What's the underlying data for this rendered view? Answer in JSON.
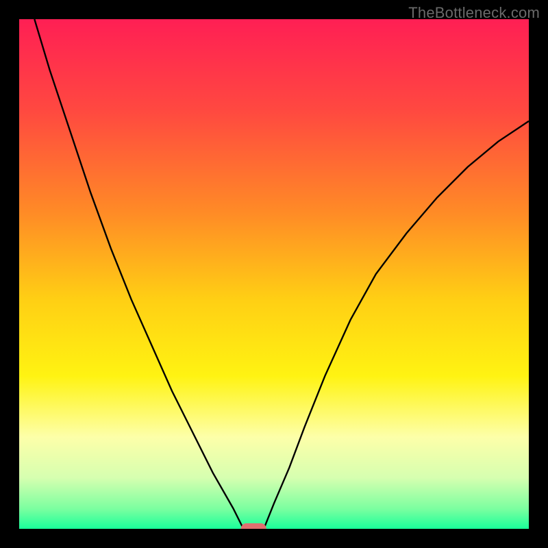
{
  "watermark": "TheBottleneck.com",
  "chart_data": {
    "type": "line",
    "title": "",
    "xlabel": "",
    "ylabel": "",
    "xlim": [
      0,
      100
    ],
    "ylim": [
      0,
      100
    ],
    "grid": false,
    "background": {
      "description": "vertical gradient from red (top) through orange and yellow to green (bottom)",
      "stops": [
        {
          "pos": 0.0,
          "color": "#ff1f54"
        },
        {
          "pos": 0.18,
          "color": "#ff4940"
        },
        {
          "pos": 0.38,
          "color": "#ff8b26"
        },
        {
          "pos": 0.55,
          "color": "#ffcf14"
        },
        {
          "pos": 0.7,
          "color": "#fff312"
        },
        {
          "pos": 0.82,
          "color": "#fdffa9"
        },
        {
          "pos": 0.9,
          "color": "#d6ffb0"
        },
        {
          "pos": 0.96,
          "color": "#7dffa0"
        },
        {
          "pos": 1.0,
          "color": "#19ff9a"
        }
      ]
    },
    "series": [
      {
        "name": "left-branch",
        "color": "#000000",
        "width": 2.4,
        "x": [
          3,
          6,
          10,
          14,
          18,
          22,
          26,
          30,
          34,
          38,
          42,
          44
        ],
        "y": [
          100,
          90,
          78,
          66,
          55,
          45,
          36,
          27,
          19,
          11,
          4,
          0
        ]
      },
      {
        "name": "right-branch",
        "color": "#000000",
        "width": 2.4,
        "x": [
          48,
          50,
          53,
          56,
          60,
          65,
          70,
          76,
          82,
          88,
          94,
          100
        ],
        "y": [
          0,
          5,
          12,
          20,
          30,
          41,
          50,
          58,
          65,
          71,
          76,
          80
        ]
      }
    ],
    "marker": {
      "name": "minimum-marker",
      "x": 46,
      "y": 0,
      "width": 5,
      "height": 2.2,
      "color": "#e07070"
    }
  }
}
